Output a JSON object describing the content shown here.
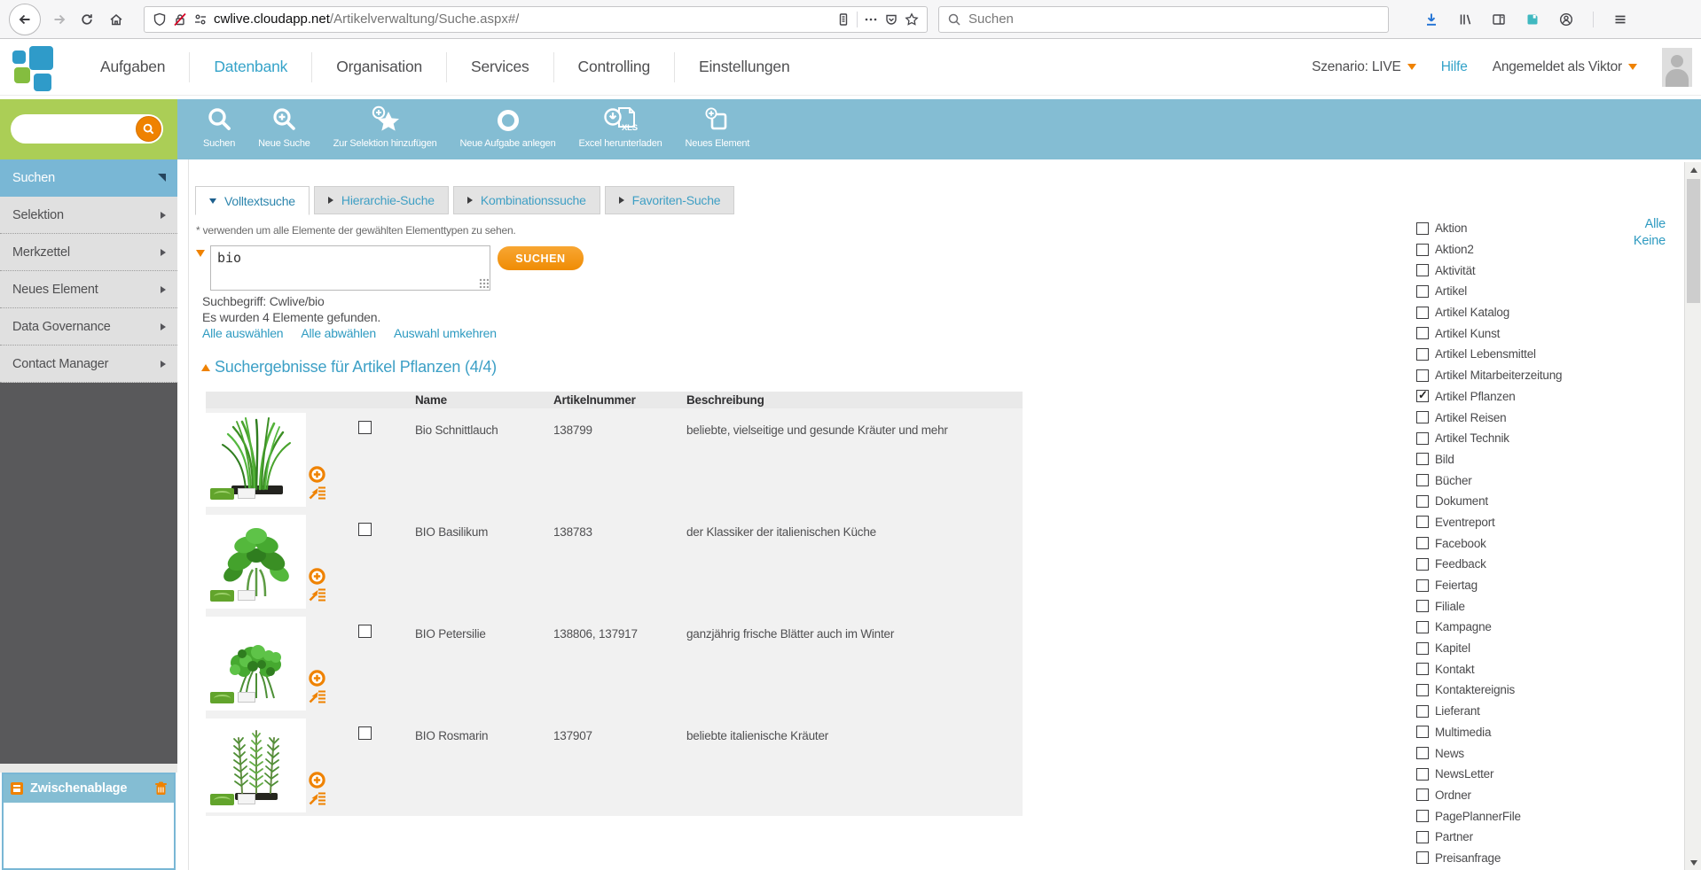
{
  "colors": {
    "accent_teal": "#84bdd3",
    "accent_green": "#abce56",
    "accent_orange": "#ef8200",
    "link_blue": "#2f9bc1",
    "nav_blue": "#35a3c9"
  },
  "browser": {
    "url_host": "cwlive.cloudapp.net",
    "url_path": "/Artikelverwaltung/Suche.aspx#/",
    "search_placeholder": "Suchen",
    "nav_icons": [
      "back-icon",
      "forward-icon",
      "reload-icon",
      "home-icon"
    ],
    "urlbar_icons": [
      "shield-icon",
      "lock-disabled-icon",
      "permissions-icon",
      "reader-mode-icon",
      "page-actions-icon",
      "pocket-icon",
      "bookmark-star-icon"
    ],
    "toolbar_icons": [
      "download-icon",
      "library-icon",
      "sidebar-toggle-icon",
      "save-session-icon",
      "account-icon",
      "menu-icon"
    ]
  },
  "app_nav": {
    "items": [
      {
        "label": "Aufgaben",
        "active": false
      },
      {
        "label": "Datenbank",
        "active": true
      },
      {
        "label": "Organisation",
        "active": false
      },
      {
        "label": "Services",
        "active": false
      },
      {
        "label": "Controlling",
        "active": false
      },
      {
        "label": "Einstellungen",
        "active": false
      }
    ],
    "scenario_label": "Szenario:",
    "scenario_value": "LIVE",
    "help_label": "Hilfe",
    "account_label": "Angemeldet als Viktor"
  },
  "action_bar": {
    "buttons": [
      {
        "label": "Suchen",
        "icon": "search"
      },
      {
        "label": "Neue Suche",
        "icon": "search-new"
      },
      {
        "label": "Zur Selektion hinzufügen",
        "icon": "star-add"
      },
      {
        "label": "Neue Aufgabe anlegen",
        "icon": "circle"
      },
      {
        "label": "Excel herunterladen",
        "icon": "excel"
      },
      {
        "label": "Neues Element",
        "icon": "element-new"
      }
    ]
  },
  "sidebar": {
    "menu": [
      {
        "label": "Suchen",
        "active": true
      },
      {
        "label": "Selektion",
        "active": false
      },
      {
        "label": "Merkzettel",
        "active": false
      },
      {
        "label": "Neues Element",
        "active": false
      },
      {
        "label": "Data Governance",
        "active": false
      },
      {
        "label": "Contact Manager",
        "active": false
      }
    ],
    "clipboard_title": "Zwischenablage"
  },
  "tabs": [
    {
      "label": "Volltextsuche",
      "active": true
    },
    {
      "label": "Hierarchie-Suche",
      "active": false
    },
    {
      "label": "Kombinationssuche",
      "active": false
    },
    {
      "label": "Favoriten-Suche",
      "active": false
    }
  ],
  "search": {
    "note": "* verwenden um alle Elemente der gewählten Elementtypen zu sehen.",
    "query": "bio",
    "submit_label": "SUCHEN",
    "term_line": "Suchbegriff: Cwlive/bio",
    "count_line": "Es wurden 4 Elemente gefunden.",
    "links": [
      "Alle auswählen",
      "Alle abwählen",
      "Auswahl umkehren"
    ]
  },
  "results": {
    "title": "Suchergebnisse für Artikel Pflanzen (4/4)",
    "columns": [
      "Name",
      "Artikelnummer",
      "Beschreibung"
    ],
    "rows": [
      {
        "image": "chives",
        "name": "Bio Schnittlauch",
        "number": "138799",
        "description": "beliebte, vielseitige und gesunde Kräuter und mehr"
      },
      {
        "image": "basil",
        "name": "BIO Basilikum",
        "number": "138783",
        "description": "der Klassiker der italienischen Küche"
      },
      {
        "image": "parsley",
        "name": "BIO Petersilie",
        "number": "138806, 137917",
        "description": "ganzjährig frische Blätter auch im Winter"
      },
      {
        "image": "rosemary",
        "name": "BIO Rosmarin",
        "number": "137907",
        "description": "beliebte italienische Kräuter"
      }
    ]
  },
  "type_filter": {
    "select_all": "Alle",
    "select_none": "Keine",
    "types": [
      {
        "label": "Aktion",
        "checked": false
      },
      {
        "label": "Aktion2",
        "checked": false
      },
      {
        "label": "Aktivität",
        "checked": false
      },
      {
        "label": "Artikel",
        "checked": false
      },
      {
        "label": "Artikel Katalog",
        "checked": false
      },
      {
        "label": "Artikel Kunst",
        "checked": false
      },
      {
        "label": "Artikel Lebensmittel",
        "checked": false
      },
      {
        "label": "Artikel Mitarbeiterzeitung",
        "checked": false
      },
      {
        "label": "Artikel Pflanzen",
        "checked": true
      },
      {
        "label": "Artikel Reisen",
        "checked": false
      },
      {
        "label": "Artikel Technik",
        "checked": false
      },
      {
        "label": "Bild",
        "checked": false
      },
      {
        "label": "Bücher",
        "checked": false
      },
      {
        "label": "Dokument",
        "checked": false
      },
      {
        "label": "Eventreport",
        "checked": false
      },
      {
        "label": "Facebook",
        "checked": false
      },
      {
        "label": "Feedback",
        "checked": false
      },
      {
        "label": "Feiertag",
        "checked": false
      },
      {
        "label": "Filiale",
        "checked": false
      },
      {
        "label": "Kampagne",
        "checked": false
      },
      {
        "label": "Kapitel",
        "checked": false
      },
      {
        "label": "Kontakt",
        "checked": false
      },
      {
        "label": "Kontaktereignis",
        "checked": false
      },
      {
        "label": "Lieferant",
        "checked": false
      },
      {
        "label": "Multimedia",
        "checked": false
      },
      {
        "label": "News",
        "checked": false
      },
      {
        "label": "NewsLetter",
        "checked": false
      },
      {
        "label": "Ordner",
        "checked": false
      },
      {
        "label": "PagePlannerFile",
        "checked": false
      },
      {
        "label": "Partner",
        "checked": false
      },
      {
        "label": "Preisanfrage",
        "checked": false
      }
    ]
  }
}
